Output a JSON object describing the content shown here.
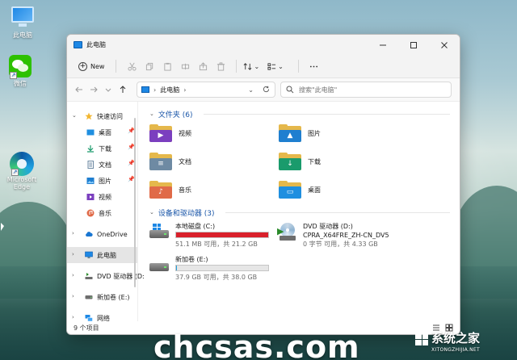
{
  "desktop": {
    "icons": [
      {
        "label": "此电脑"
      },
      {
        "label": "微信"
      },
      {
        "label": "Microsoft Edge"
      }
    ]
  },
  "window": {
    "title": "此电脑",
    "toolbar": {
      "new_label": "New"
    },
    "address": {
      "location": "此电脑",
      "search_placeholder": "搜索\"此电脑\""
    },
    "sidebar": {
      "quick_access": "快速访问",
      "quick_items": [
        {
          "label": "桌面"
        },
        {
          "label": "下载"
        },
        {
          "label": "文档"
        },
        {
          "label": "图片"
        },
        {
          "label": "视频"
        },
        {
          "label": "音乐"
        }
      ],
      "onedrive": "OneDrive",
      "this_pc": "此电脑",
      "dvd": "DVD 驱动器 (D:",
      "new_volume": "新加卷 (E:)",
      "network": "网络"
    },
    "folders": {
      "heading": "文件夹 (6)",
      "items": [
        {
          "label": "视频",
          "color": "#7b3fbf"
        },
        {
          "label": "图片",
          "color": "#1f7fd0"
        },
        {
          "label": "文档",
          "color": "#6e8aa3"
        },
        {
          "label": "下载",
          "color": "#1a9b6c"
        },
        {
          "label": "音乐",
          "color": "#e06a48"
        },
        {
          "label": "桌面",
          "color": "#1f8fe0"
        }
      ]
    },
    "drives": {
      "heading": "设备和驱动器 (3)",
      "items": [
        {
          "name": "本地磁盘 (C:)",
          "sub": "51.1 MB 可用，共 21.2 GB",
          "used_fraction": 0.998,
          "bar_color": "#d9202b"
        },
        {
          "name": "DVD 驱动器 (D:)",
          "name2": "CPRA_X64FRE_ZH-CN_DV5",
          "sub": "0 字节 可用，共 4.33 GB"
        },
        {
          "name": "新加卷 (E:)",
          "sub": "37.9 GB 可用，共 38.0 GB",
          "used_fraction": 0.003,
          "bar_color": "#26a0da"
        }
      ]
    },
    "status": {
      "count": "9 个项目"
    }
  },
  "watermark": {
    "text": "chcsas.com",
    "logo_cn": "系统之家",
    "logo_en": "XITONGZHIJIA.NET"
  }
}
